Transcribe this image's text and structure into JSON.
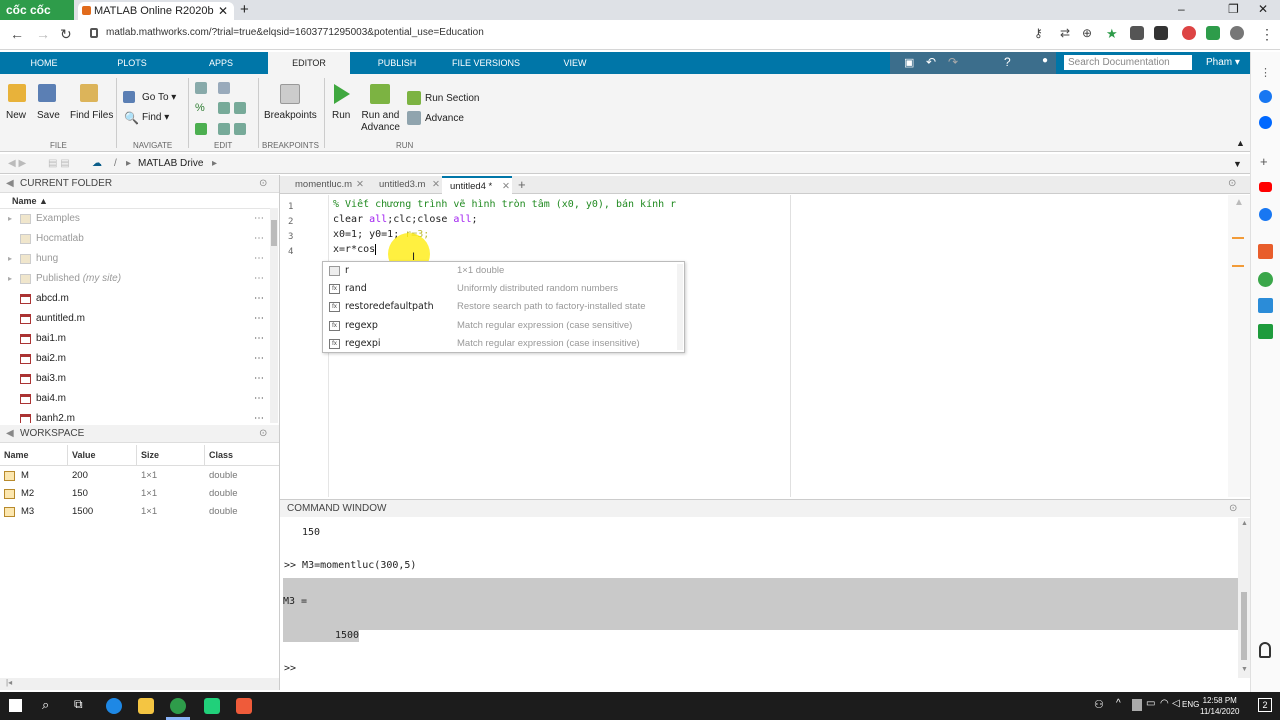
{
  "browser": {
    "brand": "cốc cốc",
    "tab_title": "MATLAB Online R2020b",
    "url": "matlab.mathworks.com/?trial=true&elqsid=1603771295003&potential_use=Education"
  },
  "matlab_tabs": [
    "HOME",
    "PLOTS",
    "APPS",
    "EDITOR",
    "PUBLISH",
    "FILE VERSIONS",
    "VIEW"
  ],
  "search_placeholder": "Search Documentation",
  "user": "Pham",
  "toolstrip": {
    "new": "New",
    "save": "Save",
    "find_files": "Find Files",
    "goto": "Go To",
    "find": "Find",
    "breakpoints": "Breakpoints",
    "run": "Run",
    "run_and_advance_1": "Run and",
    "run_and_advance_2": "Advance",
    "run_section": "Run Section",
    "advance": "Advance",
    "groups": [
      "FILE",
      "NAVIGATE",
      "EDIT",
      "BREAKPOINTS",
      "RUN"
    ]
  },
  "path": "MATLAB Drive",
  "current_folder": {
    "title": "CURRENT FOLDER",
    "col_name": "Name",
    "items": [
      {
        "name": "Examples",
        "type": "folder"
      },
      {
        "name": "Hocmatlab",
        "type": "folder"
      },
      {
        "name": "hung",
        "type": "folder"
      },
      {
        "name": "Published",
        "suffix": "(my site)",
        "type": "folder"
      },
      {
        "name": "abcd.m",
        "type": "file"
      },
      {
        "name": "auntitled.m",
        "type": "file"
      },
      {
        "name": "bai1.m",
        "type": "file"
      },
      {
        "name": "bai2.m",
        "type": "file"
      },
      {
        "name": "bai3.m",
        "type": "file"
      },
      {
        "name": "bai4.m",
        "type": "file"
      },
      {
        "name": "banh2.m",
        "type": "file"
      }
    ]
  },
  "workspace": {
    "title": "WORKSPACE",
    "columns": [
      "Name",
      "Value",
      "Size",
      "Class"
    ],
    "rows": [
      [
        "M",
        "200",
        "1×1",
        "double"
      ],
      [
        "M2",
        "150",
        "1×1",
        "double"
      ],
      [
        "M3",
        "1500",
        "1×1",
        "double"
      ]
    ]
  },
  "editor_tabs": [
    "momentluc.m",
    "untitled3.m",
    "untitled4 *"
  ],
  "code": {
    "line1": "% Viết chương trình vẽ hình tròn tâm (x0, y0), bán kính r",
    "line2_a": "clear ",
    "line2_b": "all",
    "line2_c": ";clc;close ",
    "line2_d": "all",
    "line2_e": ";",
    "line3_a": "x0=1; y0=1; ",
    "line3_b": "r=3;",
    "line4": "x=r*cos"
  },
  "autocomplete": [
    {
      "name": "r",
      "desc": "1×1 double",
      "icon": "var"
    },
    {
      "name": "rand",
      "desc": "Uniformly distributed random numbers",
      "icon": "fx"
    },
    {
      "name": "restoredefaultpath",
      "desc": "Restore search path to factory-installed state",
      "icon": "fx"
    },
    {
      "name": "regexp",
      "desc": "Match regular expression (case sensitive)",
      "icon": "fx"
    },
    {
      "name": "regexpi",
      "desc": "Match regular expression (case insensitive)",
      "icon": "fx"
    }
  ],
  "command_window": {
    "title": "COMMAND WINDOW",
    "prev_value": "150",
    "command": ">> M3=momentluc(300,5)",
    "result_label": "M3 =",
    "result_value": "1500",
    "prompt": ">>"
  },
  "taskbar": {
    "lang": "ENG",
    "time": "12:58 PM",
    "date": "11/14/2020",
    "notif": "2"
  }
}
